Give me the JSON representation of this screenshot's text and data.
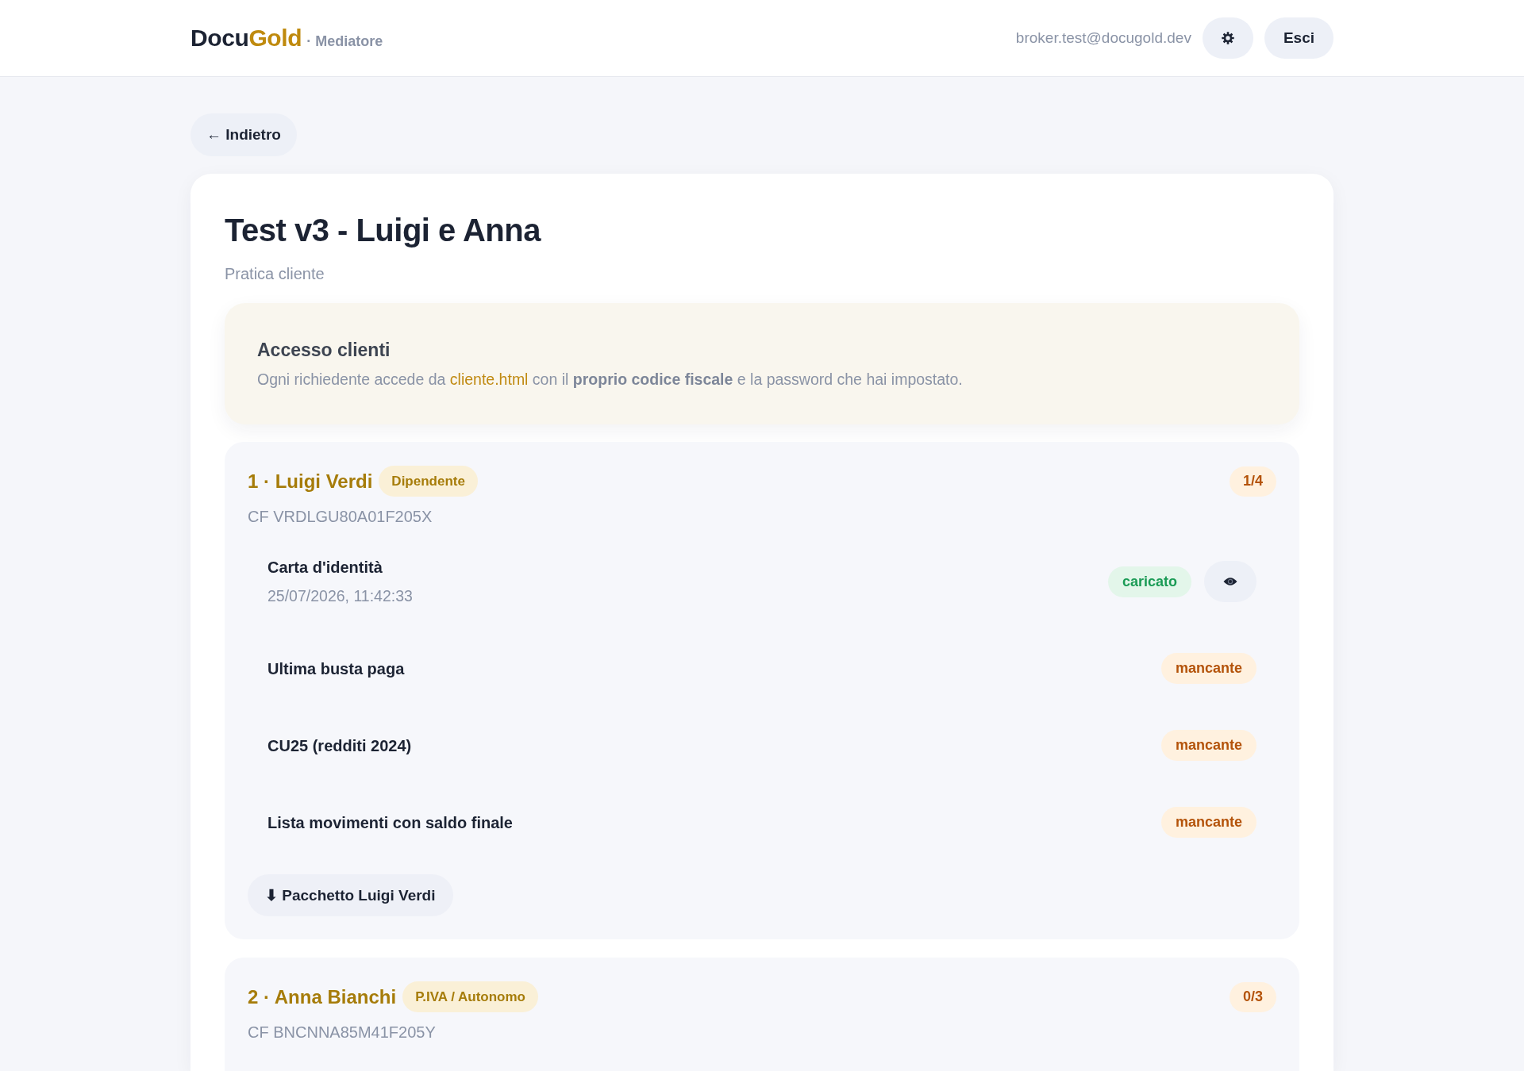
{
  "header": {
    "brand_dark": "Docu",
    "brand_gold": "Gold",
    "role": "· Mediatore",
    "user_email": "broker.test@docugold.dev",
    "logout_label": "Esci"
  },
  "back_button": "← Indietro",
  "practice": {
    "title": "Test v3 - Luigi e Anna",
    "subtitle": "Pratica cliente"
  },
  "client_access": {
    "title": "Accesso clienti",
    "text_start": "Ogni richiedente accede da ",
    "link": "cliente.html",
    "text_end": " con il **proprio codice fiscale** e la password che hai impostato."
  },
  "applicants": [
    {
      "name": "1 · Luigi Verdi",
      "type": "Dipendente",
      "progress": "1/4",
      "tax_code": "CF VRDLGU80A01F205X",
      "documents": [
        {
          "kind": "uploaded",
          "title": "Carta d'identità",
          "uploaded_at": "25/07/2026, 11:42:33",
          "status": "caricato"
        },
        {
          "kind": "missing",
          "title": "Ultima busta paga",
          "status": "mancante"
        },
        {
          "kind": "missing",
          "title": "CU25 (redditi 2024)",
          "status": "mancante"
        },
        {
          "kind": "missing",
          "title": "Lista movimenti con saldo finale",
          "status": "mancante"
        }
      ],
      "download_label": "⬇ Pacchetto Luigi Verdi"
    },
    {
      "name": "2 · Anna Bianchi",
      "type": "P.IVA / Autonomo",
      "progress": "0/3",
      "tax_code": "CF BNCNNA85M41F205Y"
    }
  ]
}
